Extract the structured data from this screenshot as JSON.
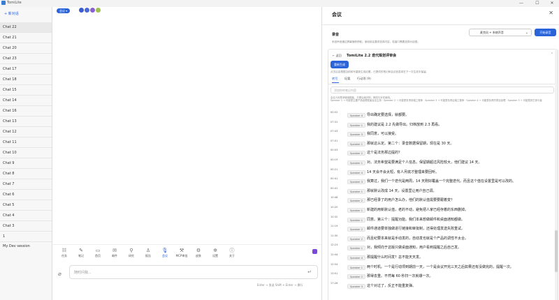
{
  "app": {
    "title": "TomiLite"
  },
  "window_controls": {
    "minimize": "—",
    "maximize": "☐",
    "close": "✕"
  },
  "sidebar": {
    "new_chat": "+ 新对话",
    "chats": [
      "Chat 22",
      "Chat 21",
      "Chat 20",
      "Chat 23",
      "Chat 17",
      "Chat 18",
      "Chat 15",
      "Chat 14",
      "Chat 16",
      "Chat 13",
      "Chat 12",
      "Chat 11",
      "Chat 10",
      "Chat 9",
      "Chat 8",
      "Chat 7",
      "Chat 6",
      "Chat 5",
      "Chat 4",
      "Chat 3",
      "1"
    ],
    "dev_session": "My Dev session"
  },
  "main": {
    "model_chip": "会议 ▾",
    "dot_colors": [
      "#3b5ccf",
      "#4a69d9",
      "#8a5fd1",
      "#9fbf4f"
    ],
    "tools": [
      {
        "icon": "☷",
        "label": "任务",
        "name": "task"
      },
      {
        "icon": "✎",
        "label": "笔记",
        "name": "notes"
      },
      {
        "icon": "▭",
        "label": "首页",
        "name": "home"
      },
      {
        "icon": "✉",
        "label": "邮件",
        "name": "mail"
      },
      {
        "icon": "⚲",
        "label": "研究",
        "name": "research"
      },
      {
        "icon": "♙",
        "label": "报告",
        "name": "report"
      },
      {
        "icon": "🎙",
        "label": "会议",
        "name": "meeting",
        "active": true
      },
      {
        "icon": "⚒",
        "label": "MCP审批",
        "name": "mcp"
      },
      {
        "icon": "⚙",
        "label": "皮肤",
        "name": "skin"
      },
      {
        "icon": "✲",
        "label": "设置",
        "name": "settings"
      },
      {
        "icon": "ⓘ",
        "label": "关于",
        "name": "about"
      }
    ],
    "input_placeholder": "随时问我...",
    "hint": "Enter → 发送    Shift + Enter → 换行"
  },
  "meeting_panel": {
    "title": "会议",
    "close": "✕",
    "recording_label": "录音",
    "recording_desc": "系统声音通过屏幕捕获获取；使用前会要求选择内容，若窗口需要选择对话框。",
    "source_select": "麦克风 + 系统声音",
    "start_button": "开始录音",
    "back": "← 返回",
    "meeting_name": "TomiLite 2.2 迭代规划评审会",
    "regen_button": "重新生成",
    "regen_hint": "点击后会根据当前转写重新生成纪要，已提供的笔记和会议信息将在下一次生成中保留。",
    "tabs": [
      {
        "label": "转写",
        "active": true
      },
      {
        "label": "纪要",
        "active": false
      },
      {
        "label": "行动项 (9)",
        "active": false
      }
    ],
    "notes_placeholder": "添加你的笔记内容",
    "gen_hint": "会议人标签请使用模板，方便后续识别、修改与补充使用。",
    "speaker_legend": "Speaker 1 → 可能是主要产品经理或者会议主持 · Speaker 2 → 可能是负责前端工程师 · Speaker 3 → 可能是负责后端工程师 · Speaker 4 → 可能是负责的项目经理 · Speaker 5 → 可能是其它参与者",
    "transcript": [
      {
        "time": "00:52",
        "speaker": "Speaker 4",
        "text": "导出确定要选择，就都要。"
      },
      {
        "time": "07:31",
        "speaker": "Speaker 1",
        "text": "我的建议是 2.2 先做导出。归档放到 2.3 再看。"
      },
      {
        "time": "07:43",
        "speaker": "Speaker 3",
        "text": "我同意，可以接受。"
      },
      {
        "time": "07:01",
        "speaker": "Speaker 1",
        "text": "那就这么定。第二个：录音数据保留期，现在是 30 天。"
      },
      {
        "time": "00:03",
        "speaker": "Speaker 2",
        "text": "这个是法务那边提的？"
      },
      {
        "time": "00:19",
        "speaker": "Speaker 1",
        "text": "对。法务希望是要满足个人信息。保留期超过风险较大，他们建议 14 天。"
      },
      {
        "time": "00:21",
        "speaker": "Speaker 4",
        "text": "14 天会不会太短，有人月底才整理来要回听。"
      },
      {
        "time": "00:41",
        "speaker": "Speaker 3",
        "text": "我算过，我们一个迭代是两周，14 天刚好覆盖一个完整迭代。而且这个值在设置里是可以改的。"
      },
      {
        "time": "00:41",
        "speaker": "Speaker 1",
        "text": "那就默认改成 14 天，设置里让用户自己调。"
      },
      {
        "time": "10:46",
        "speaker": "Speaker 2",
        "text": "那已经录了的用户怎么办，他们的默认值需要要跟着变？"
      },
      {
        "time": "10:20",
        "speaker": "Speaker 1",
        "text": "新建的用新默认值，老的不动，避免把人家已经存着的东西删掉。"
      },
      {
        "time": "10:32",
        "speaker": "Speaker 1",
        "text": "同意。第三个：提醒功能。我们本来想做邮件和桌面通知都做。"
      },
      {
        "time": "11:19",
        "speaker": "Speaker 2",
        "text": "邮件通道要单独做进行链接和审批制，还得处理发送失败重试。"
      },
      {
        "time": "11:30",
        "speaker": "Speaker 2",
        "text": "而且纪要本来就是手动发的，自动发也就是个产品的调性不太合。"
      },
      {
        "time": "12:23",
        "speaker": "Speaker 1",
        "text": "对，我倾向于这版只做桌面通知，用户看到提醒之后自己发。"
      },
      {
        "time": "12:44",
        "speaker": "Speaker 4",
        "text": "那提醒什么时间发？总不能天天发。"
      },
      {
        "time": "12:54",
        "speaker": "Speaker 1",
        "text": "两个时机。一个是行动项到期前一天，一个是会议开完三天之后如果还有没做完的，提醒一次。"
      },
      {
        "time": "13:01",
        "speaker": "Speaker 2",
        "text": "那得去重。不然每 60 秒扫一次就爆一次。"
      },
      {
        "time": "17:26",
        "speaker": "Speaker 3",
        "text": "这个对过了，反正不能重复弹。"
      }
    ]
  }
}
